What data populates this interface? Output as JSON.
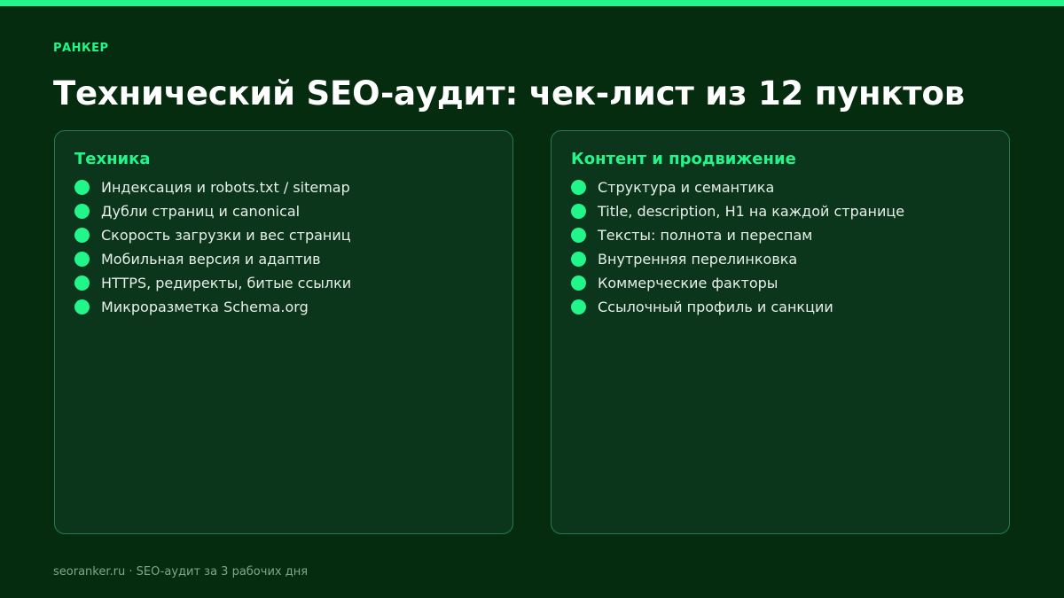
{
  "brand": "РАНКЕР",
  "title": "Технический SEO-аудит: чек-лист из 12 пунктов",
  "cards": [
    {
      "heading": "Техника",
      "items": [
        "Индексация и robots.txt / sitemap",
        "Дубли страниц и canonical",
        "Скорость загрузки и вес страниц",
        "Мобильная версия и адаптив",
        "HTTPS, редиректы, битые ссылки",
        "Микроразметка Schema.org"
      ]
    },
    {
      "heading": "Контент и продвижение",
      "items": [
        "Структура и семантика",
        "Title, description, H1 на каждой странице",
        "Тексты: полнота и переспам",
        "Внутренняя перелинковка",
        "Коммерческие факторы",
        "Ссылочный профиль и санкции"
      ]
    }
  ],
  "footer": "seoranker.ru · SEO-аудит за 3 рабочих дня",
  "colors": {
    "background": "#062c10",
    "accent": "#22f58a",
    "card_background": "#0c361c",
    "card_border": "#257a55"
  }
}
